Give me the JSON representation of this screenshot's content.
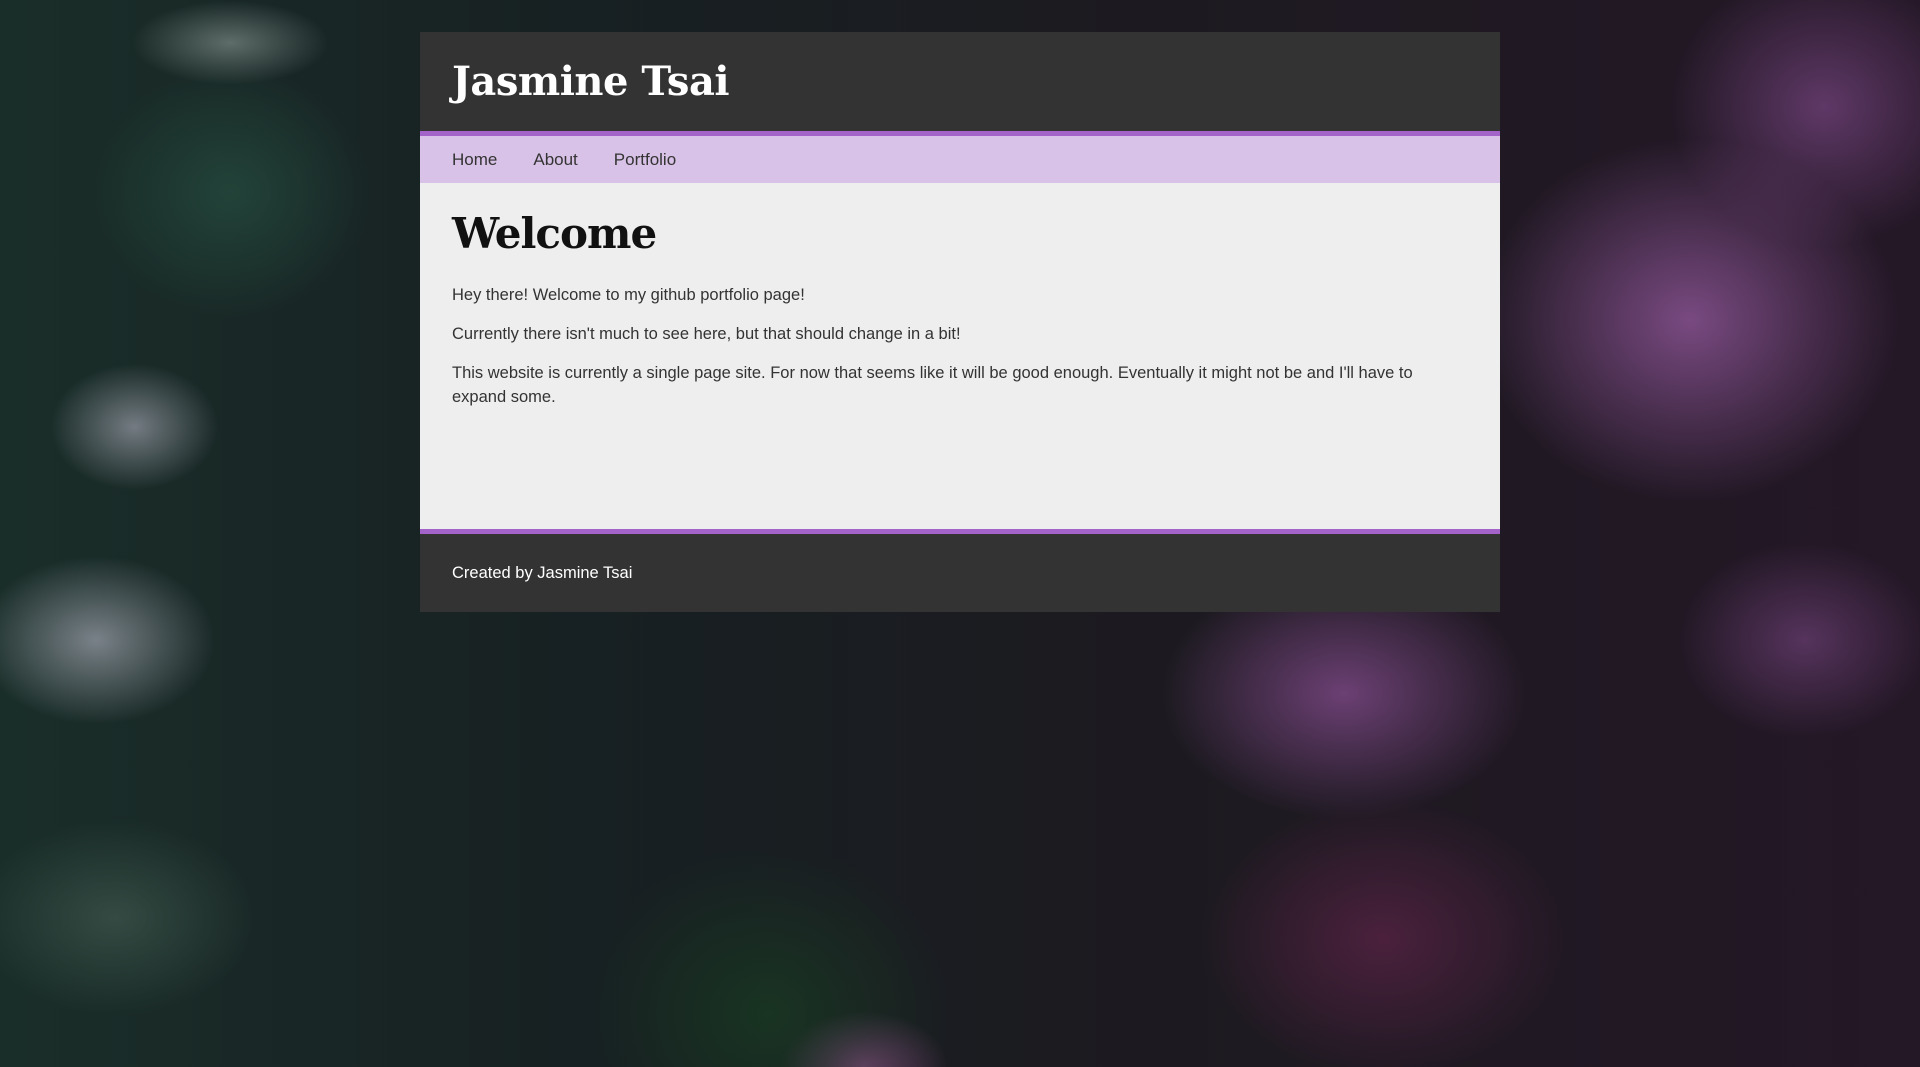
{
  "header": {
    "site_title": "Jasmine Tsai"
  },
  "nav": {
    "items": [
      {
        "label": "Home"
      },
      {
        "label": "About"
      },
      {
        "label": "Portfolio"
      }
    ]
  },
  "main": {
    "heading": "Welcome",
    "paragraphs": [
      "Hey there! Welcome to my github portfolio page!",
      "Currently there isn't much to see here, but that should change in a bit!",
      "This website is currently a single page site. For now that seems like it will be good enough. Eventually it might not be and I'll have to expand some."
    ]
  },
  "footer": {
    "text": "Created by Jasmine Tsai"
  },
  "colors": {
    "header_bg": "#333333",
    "accent": "#a463c8",
    "nav_bg": "#d9c2e7",
    "content_bg": "#eeeeee",
    "footer_bg": "#333333"
  }
}
